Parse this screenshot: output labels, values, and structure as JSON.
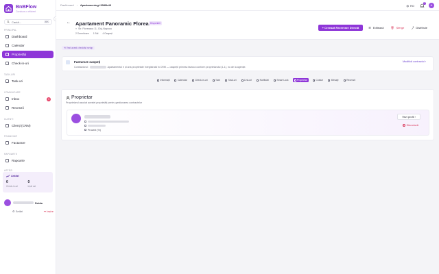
{
  "brand": {
    "name": "BnBFlow",
    "tagline": "Conduce-o eficient"
  },
  "sidebar": {
    "search_placeholder": "Caută...",
    "search_shortcut": "⌘K",
    "sections": {
      "principal": "PRINCIPAL",
      "task": "TASK-URI",
      "comunicare": "COMUNICARE",
      "clienti": "CLIENȚI",
      "financiar": "FINANCIAR",
      "rapoarte": "RAPOARTE",
      "astazi": "ASTĂZI"
    },
    "items": {
      "dashboard": "Dashboard",
      "calendar": "Calendar",
      "proprietati": "Proprietăți",
      "checkin": "Check-in-uri",
      "taskuri": "Task-uri",
      "inbox": "Inbox",
      "recenzii": "Recenzii",
      "clienti": "Clienți (CRM)",
      "facturare": "Facturare",
      "rapoarte": "Rapoarte"
    },
    "inbox_badge": "3",
    "today": {
      "title": "Astăzi",
      "checkins_value": "0",
      "checkins_label": "Check-in-uri",
      "checkouts_value": "0",
      "checkouts_label": "Ieșiri azi"
    },
    "user_name_suffix": "Deida",
    "settings": "Setări",
    "logout": "Ieșire"
  },
  "topbar": {
    "crumb_root": "Dashboard",
    "crumb_sep": "›",
    "crumb_current": "Apartamentegt 3980b43",
    "lang": "RO",
    "notif_count": "10",
    "avatar_initial": "A"
  },
  "header": {
    "back": "←",
    "title": "Apartament Panoramic Floreasca",
    "status": "Disponibil",
    "address": "Str. Floreasca 11, Cluj-Napoca",
    "meta": [
      "2 Dormitoare",
      "1 Băi",
      "4 Oaspeți"
    ],
    "btn_create": "+ Creează Rezervare Directă",
    "btn_edit": "Editează",
    "btn_delete": "Șterge",
    "btn_share": "Distribuie"
  },
  "wizard_link": "⟲ Vezi acest checklist setup",
  "invoice": {
    "title": "Facturare oaspeți",
    "desc_prefix": "Contractorul:",
    "desc_suffix": "Apartamentul e și una proprietate înregistrată în CRM — oaspeții primesc factura conform proprietarului (1-1), nu de la agenție.",
    "link": "Modifică contractul ›"
  },
  "tabs": [
    "Informații",
    "Calendar",
    "Check-in-uri",
    "Taxe",
    "Task-uri",
    "Link-uri",
    "Notificări",
    "Smart Lock",
    "Proprietar",
    "Costuri",
    "Mesaje",
    "Recenzii"
  ],
  "tabs_active": "Proprietar",
  "owner": {
    "heading": "Proprietar",
    "subheading": "Proprietarul asociat acestei proprietăți pentru gestionarea contractelor",
    "percent": "Procent (%)",
    "btn_view": "Vezi profil",
    "btn_unlink": "Disociază"
  },
  "colors": {
    "accent": "#8e36d8",
    "danger": "#d9395b",
    "brand": "#7a2fc8"
  }
}
